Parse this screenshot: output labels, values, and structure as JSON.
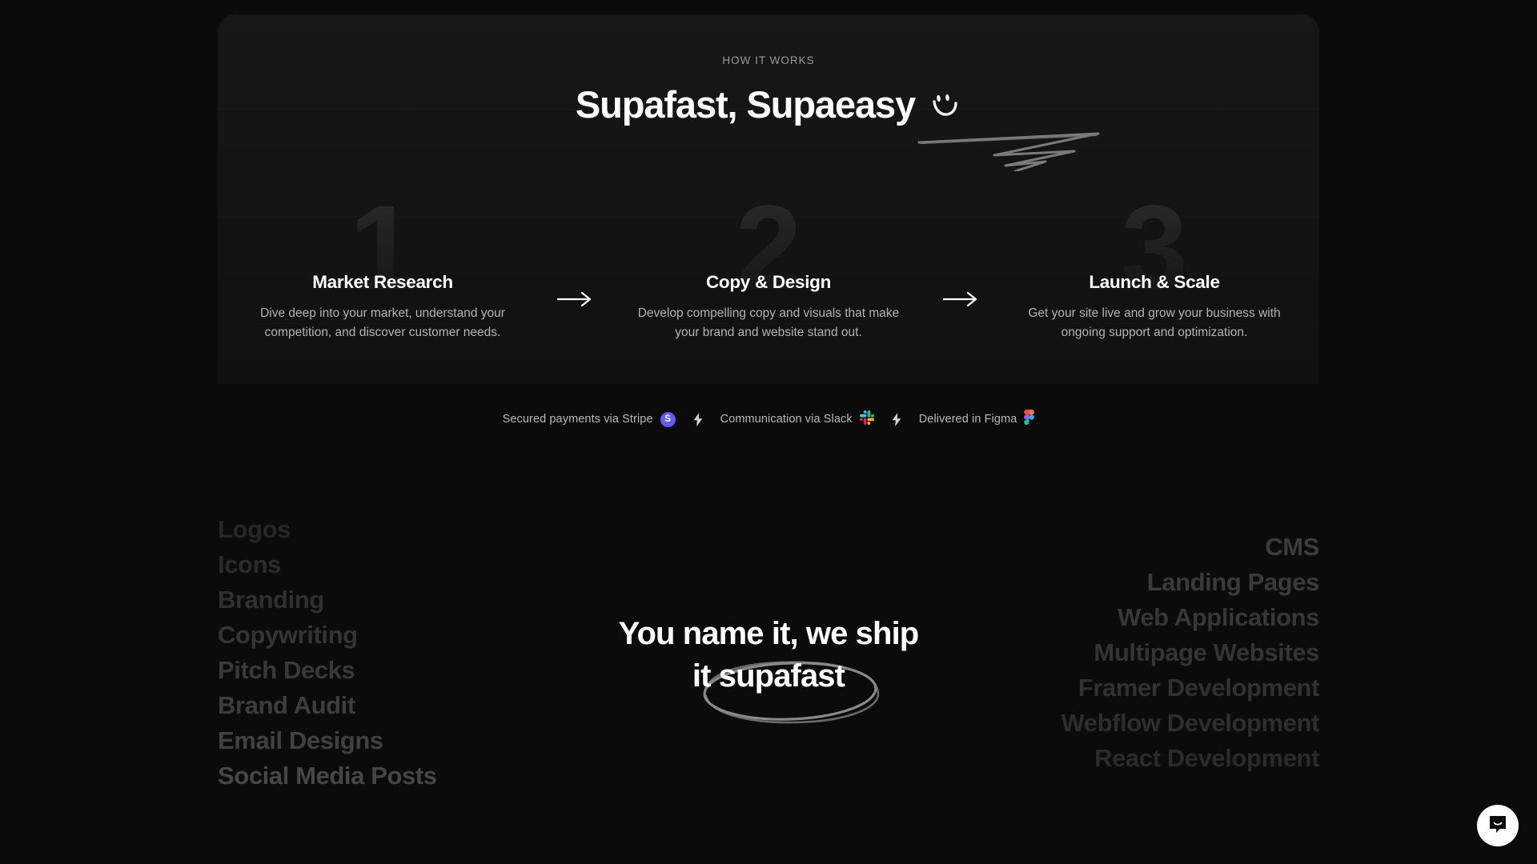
{
  "how_it_works": {
    "eyebrow": "HOW IT WORKS",
    "title": "Supafast, Supaeasy",
    "smiley_icon": "hand-drawn-smiley-icon",
    "underline_icon": "scribble-underline-icon",
    "steps": [
      {
        "number": "1",
        "title": "Market Research",
        "description": "Dive deep into your market, understand your competition, and discover customer needs."
      },
      {
        "number": "2",
        "title": "Copy & Design",
        "description": "Develop compelling copy and visuals that make your brand and website stand out."
      },
      {
        "number": "3",
        "title": "Launch & Scale",
        "description": "Get your site live and grow your business with ongoing support and optimization."
      }
    ],
    "arrow_icon": "arrow-right-icon"
  },
  "badges": {
    "items": [
      {
        "text": "Secured payments via Stripe",
        "icon": "stripe-icon",
        "icon_glyph": "S",
        "icon_color": "#635bff"
      },
      {
        "text": "Communication via Slack",
        "icon": "slack-icon",
        "icon_color": "#e01e5a"
      },
      {
        "text": "Delivered in Figma",
        "icon": "figma-icon",
        "icon_color": "#f24e1e"
      }
    ],
    "separator_icon": "lightning-bolt-icon"
  },
  "marquee": {
    "left_items": [
      "Logos",
      "Icons",
      "Branding",
      "Copywriting",
      "Pitch Decks",
      "Brand Audit",
      "Email Designs",
      "Social Media Posts"
    ],
    "right_items": [
      "CMS",
      "Landing Pages",
      "Web Applications",
      "Multipage Websites",
      "Framer Development",
      "Webflow Development",
      "React Development"
    ]
  },
  "center_headline": {
    "line1": "You name it, we ship",
    "line2_prefix": "it ",
    "line2_highlight": "supafast",
    "circle_icon": "hand-drawn-ellipse-icon"
  },
  "chat": {
    "icon": "intercom-chat-icon",
    "label": "Open chat"
  },
  "colors": {
    "page_background": "#0b0b0b",
    "card_background": "#161616",
    "text_primary": "#ffffff",
    "text_secondary": "#b4b4b4",
    "muted_list": "#2b2b2b",
    "stripe_purple": "#635bff"
  }
}
